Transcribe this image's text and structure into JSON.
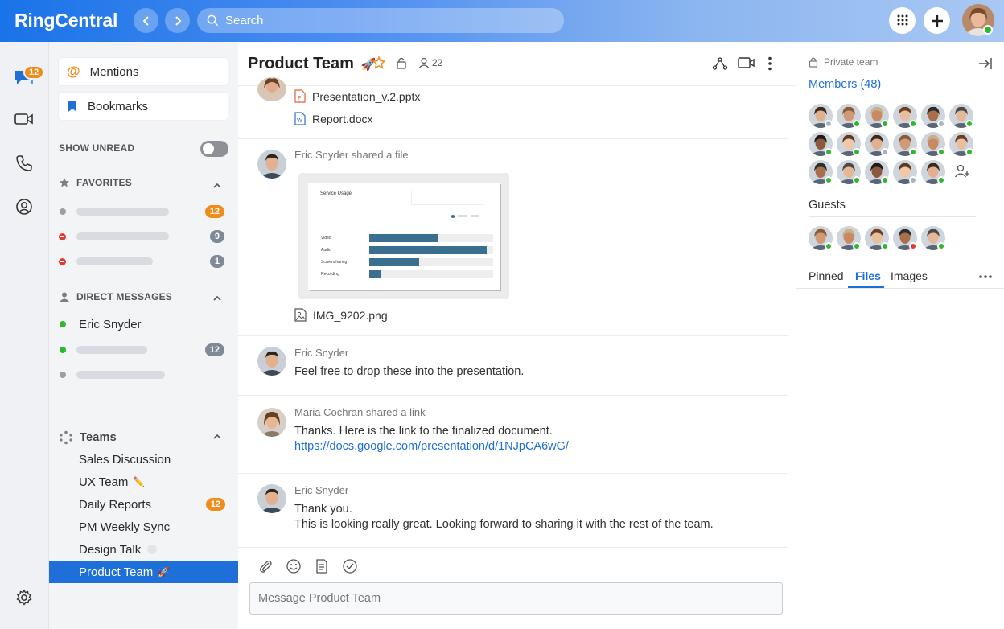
{
  "app": {
    "brand": "RingCentral"
  },
  "search": {
    "placeholder": "Search"
  },
  "rail": {
    "messages_badge": "12"
  },
  "sidebar": {
    "mentions": "Mentions",
    "bookmarks": "Bookmarks",
    "show_unread": "SHOW UNREAD",
    "favorites": "FAVORITES",
    "fav_counts": [
      "12",
      "9",
      "1"
    ],
    "direct_messages": "DIRECT MESSAGES",
    "dm_name": "Eric Snyder",
    "dm_count": "12",
    "teams_label": "Teams",
    "teams": [
      "Sales Discussion",
      "UX Team",
      "Daily Reports",
      "PM Weekly Sync",
      "Design Talk",
      "Product Team"
    ],
    "teams_emoji": {
      "ux": "✏️",
      "product": "🚀"
    },
    "daily_reports_count": "12"
  },
  "chat": {
    "title": "Product Team",
    "title_emoji": "🚀",
    "members_count": "22",
    "files": [
      "Presentation_v.2.pptx",
      "Report.docx"
    ],
    "msg1_meta": "Eric Snyder shared a file",
    "image_file": "IMG_9202.png",
    "preview": {
      "title": "Service Usage",
      "rows": [
        "Video",
        "Audio",
        "Screensharing",
        "Recording"
      ],
      "values": [
        0.55,
        0.95,
        0.4,
        0.1
      ]
    },
    "msg2_meta": "Eric Snyder",
    "msg2_text": "Feel free to drop these into the presentation.",
    "msg3_meta": "Maria Cochran shared  a link",
    "msg3_text": "Thanks. Here is the link to the finalized document.",
    "msg3_link": "https://docs.google.com/presentation/d/1NJpCA6wG/",
    "msg4_meta": "Eric Snyder",
    "msg4_line1": "Thank you.",
    "msg4_line2": "This is looking really great. Looking forward to sharing it with the rest of the team.",
    "composer_placeholder": "Message Product Team"
  },
  "rpanel": {
    "private_team": "Private team",
    "members": "Members (48)",
    "guests": "Guests",
    "tabs": [
      "Pinned",
      "Files",
      "Images"
    ],
    "active_tab": "Files"
  }
}
